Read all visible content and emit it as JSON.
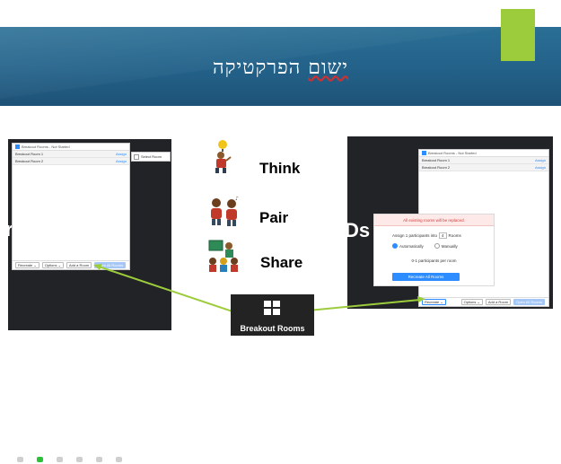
{
  "slide": {
    "title_part1": "ישום",
    "title_part2": " הפרקטיקה"
  },
  "left_screen": {
    "window_title": "Breakout Rooms - Not Started",
    "rooms": [
      {
        "name": "Breakout Room 1",
        "action": "Assign"
      },
      {
        "name": "Breakout Room 2",
        "action": "Assign"
      }
    ],
    "side_checkbox_label": "Select Room",
    "footer": {
      "recreate": "Recreate ⌄",
      "options": "Options ⌄",
      "add_room": "Add a Room",
      "open_all": "Open All Rooms"
    },
    "background_fragment": "r"
  },
  "right_screen": {
    "window_title": "Breakout Rooms - Not Started",
    "rooms": [
      {
        "name": "Breakout Room 1",
        "action": "Assign"
      },
      {
        "name": "Breakout Room 2",
        "action": "Assign"
      }
    ],
    "dialog": {
      "warning": "All existing rooms will be replaced.",
      "assign_prefix": "Assign 1 participants into",
      "room_count": "4",
      "rooms_suffix": "Rooms",
      "option_auto": "Automatically",
      "option_manual": "Manually",
      "per_room": "0-1 participants per room",
      "recreate_all": "Recreate All Rooms"
    },
    "footer": {
      "recreate": "Recreate ⌄",
      "options": "Options ⌄",
      "add_room": "Add a Room",
      "open_all": "Open All Rooms"
    },
    "background_fragment": "Ds"
  },
  "practice": {
    "think": "Think",
    "pair": "Pair",
    "share": "Share"
  },
  "breakout_button": {
    "label": "Breakout Rooms",
    "icon": "grid-icon"
  },
  "colors": {
    "banner": "#236189",
    "accent_green": "#9ccc3c",
    "zoom_blue": "#2d8cff",
    "arrow_green": "#9ccc3c"
  }
}
